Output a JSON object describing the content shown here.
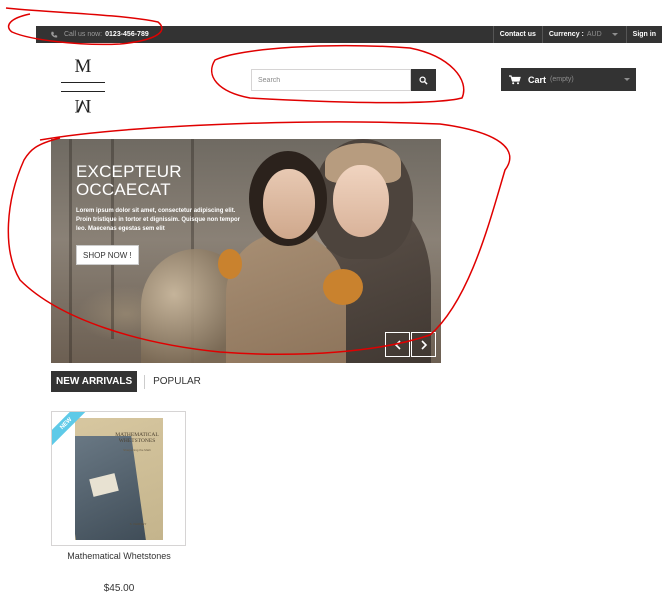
{
  "topbar": {
    "call_label": "Call us now:",
    "phone": "0123-456-789",
    "contact": "Contact us",
    "currency_label": "Currency :",
    "currency_value": "AUD",
    "sign_in": "Sign in"
  },
  "logo": {
    "top": "M",
    "bottom": "M"
  },
  "search": {
    "placeholder": "Search"
  },
  "cart": {
    "label": "Cart",
    "status": "(empty)"
  },
  "banner": {
    "title": "EXCEPTEUR OCCAECAT",
    "description": "Lorem ipsum dolor sit amet, consectetur adipiscing elit. Proin tristique in tortor et dignissim. Quisque non tempor leo. Maecenas egestas sem elit",
    "button": "SHOP NOW !"
  },
  "tabs": {
    "active": "NEW ARRIVALS",
    "other": "POPULAR"
  },
  "product": {
    "badge": "NEW",
    "book_title": "MATHEMATICAL WHETSTONES",
    "book_subtitle": "Sharpening the Math",
    "book_author": "S. KEIRSEY",
    "name": "Mathematical Whetstones",
    "price": "$45.00"
  },
  "colors": {
    "dark": "#333333",
    "badge": "#5ecae8",
    "annotation": "#e00000"
  }
}
